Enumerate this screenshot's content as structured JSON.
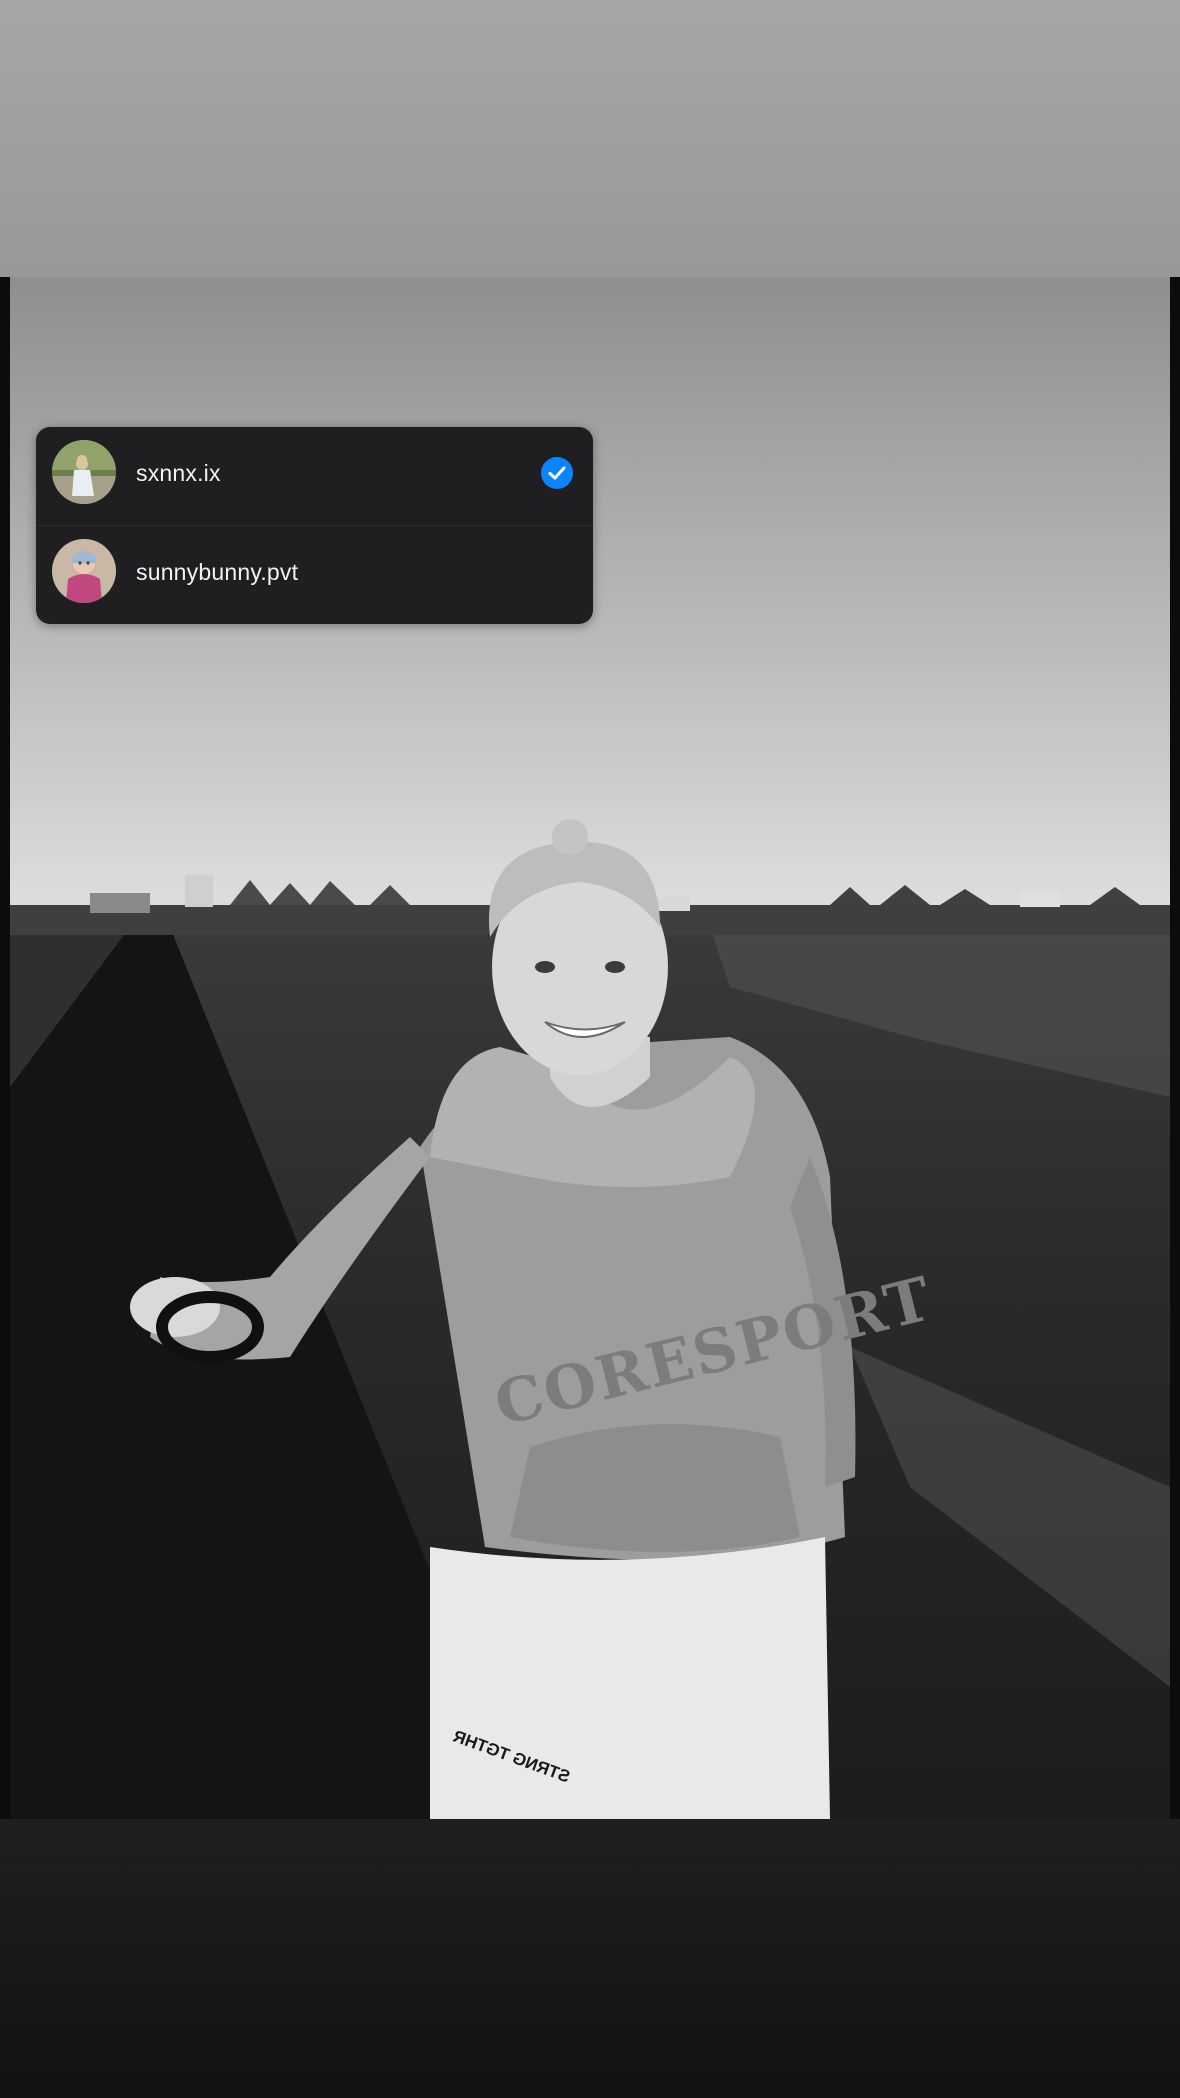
{
  "story": {
    "accounts": [
      {
        "username": "sxnnx.ix",
        "selected": true,
        "avatar_icon": "profile-photo"
      },
      {
        "username": "sunnybunny.pvt",
        "selected": false,
        "avatar_icon": "profile-photo"
      }
    ],
    "accent_color": "#0a84ff",
    "menu_background": "#1f1f22",
    "photo": {
      "hoodie_text": "CORESPORT",
      "pants_text": "STRNG TGTHR"
    }
  }
}
